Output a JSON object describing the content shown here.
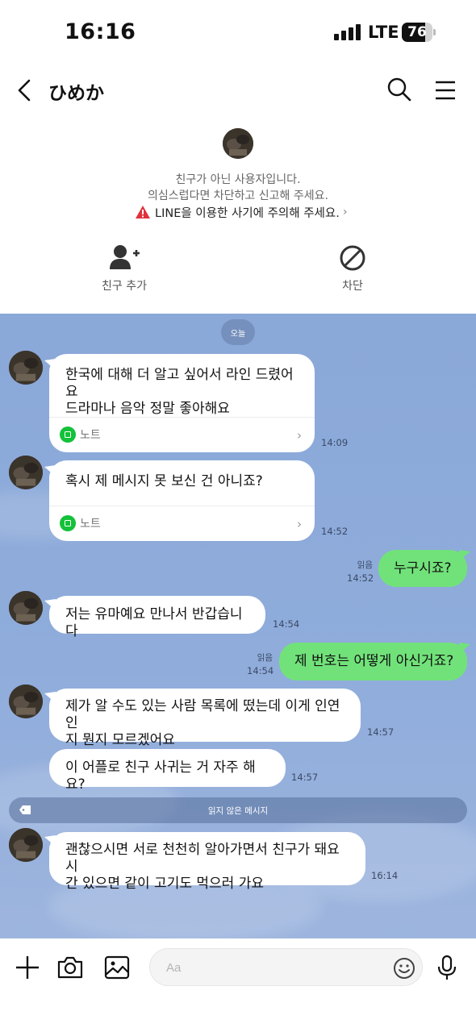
{
  "status_bar": {
    "time": "16:16",
    "network": "LTE",
    "battery": "76",
    "battery_level_percent": 76
  },
  "header": {
    "title": "ひめか",
    "icons": [
      "back-arrow-icon",
      "search-icon",
      "menu-icon"
    ]
  },
  "profile_notice": {
    "line1": "친구가 아닌 사용자입니다.",
    "line2": "의심스럽다면 차단하고 신고해 주세요.",
    "warning": "LINE을 이용한 사기에 주의해 주세요."
  },
  "actions": {
    "add_friend": "친구 추가",
    "block": "차단"
  },
  "chat": {
    "date_label": "오늘",
    "note_label": "노트",
    "unread_label": "읽지 않은 메시지",
    "messages": [
      {
        "direction": "in",
        "text": "한국에 대해 더 알고 싶어서 라인 드렸어요\n드라마나 음악 정말 좋아해요",
        "time": "14:09",
        "has_note": true
      },
      {
        "direction": "in",
        "text": "혹시 제 메시지 못 보신 건 아니죠?",
        "time": "14:52",
        "has_note": true
      },
      {
        "direction": "out",
        "text": "누구시죠?",
        "time": "14:52",
        "read": "읽음"
      },
      {
        "direction": "in",
        "text": "저는 유마예요 만나서 반갑습니다",
        "time": "14:54"
      },
      {
        "direction": "out",
        "text": "제 번호는 어떻게 아신거죠?",
        "time": "14:54",
        "read": "읽음"
      },
      {
        "direction": "in",
        "text": "제가 알 수도 있는 사람 목록에 떴는데 이게 인연인\n지 뭔지 모르겠어요",
        "time": "14:57"
      },
      {
        "direction": "in",
        "text": "이 어플로 친구 사귀는 거 자주 해요?",
        "time": "14:57"
      },
      {
        "direction": "in",
        "text": "괜찮으시면 서로 천천히 알아가면서 친구가 돼요 시\n간 있으면 같이 고기도 먹으러 가요",
        "time": "16:14"
      }
    ]
  },
  "input": {
    "placeholder": "Aa",
    "icons": [
      "plus-icon",
      "camera-icon",
      "image-icon",
      "emoji-icon",
      "microphone-icon"
    ]
  },
  "colors": {
    "chat_background": "#8aa8d8",
    "outgoing_bubble": "#71e27a",
    "warning_red": "#e0323c",
    "note_green": "#13c13a"
  }
}
